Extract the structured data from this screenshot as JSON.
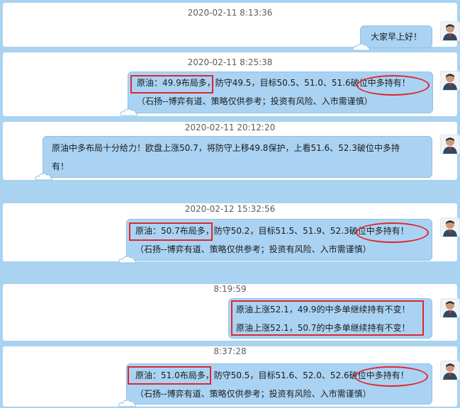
{
  "messages": [
    {
      "time": "2020-02-11 8:13:36",
      "lines": [
        "大家早上好！"
      ]
    },
    {
      "time": "2020-02-11 8:25:38",
      "lines": [
        "原油：49.9布局多，防守49.5，目标50.5、51.0、51.6破位中多持有！",
        "（石扬--博弈有道、策略仅供参考；投资有风险、入市需谨慎）"
      ]
    },
    {
      "time": "2020-02-11 20:12:20",
      "lines": [
        "原油中多布局十分给力！欧盘上涨50.7，将防守上移49.8保护，上看51.6、52.3破位中多持",
        "有！"
      ]
    },
    {
      "time": "2020-02-12 15:32:56",
      "lines": [
        "原油：50.7布局多，防守50.2，目标51.5、51.9、52.3破位中多持有！",
        "（石扬--博弈有道、策略仅供参考；投资有风险、入市需谨慎）"
      ]
    },
    {
      "time": "8:19:59",
      "lines": [
        "原油上涨52.1，49.9的中多单继续持有不变！",
        "原油上涨52.1，50.7的中多单继续持有不变！"
      ]
    },
    {
      "time": "8:37:28",
      "lines": [
        "原油：51.0布局多，防守50.5，目标51.6、52.0、52.6破位中多持有！",
        "（石扬--博弈有道、策略仅供参考；投资有风险、入市需谨慎）"
      ]
    }
  ],
  "colors": {
    "background": "#a9d3f0",
    "bubble": "#aad3f3",
    "highlight": "#e0262e"
  },
  "icons": {
    "avatar": "avatar-icon",
    "cloud": "cloud-icon"
  }
}
